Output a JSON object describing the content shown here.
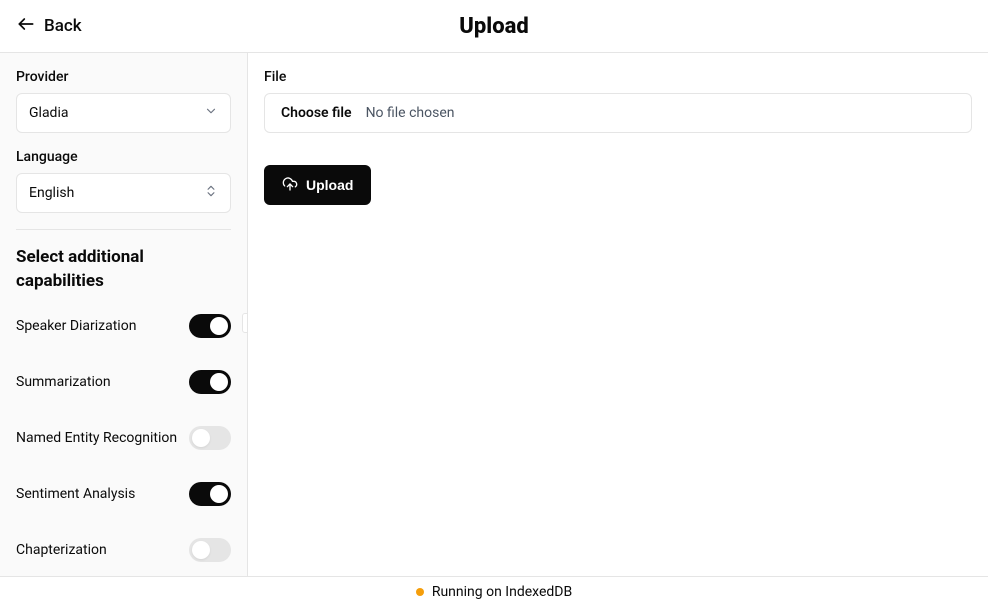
{
  "header": {
    "back_label": "Back",
    "title": "Upload"
  },
  "sidebar": {
    "provider_label": "Provider",
    "provider_value": "Gladia",
    "language_label": "Language",
    "language_value": "English",
    "section_heading": "Select additional capabilities",
    "capabilities": [
      {
        "label": "Speaker Diarization",
        "on": true
      },
      {
        "label": "Summarization",
        "on": true
      },
      {
        "label": "Named Entity Recognition",
        "on": false
      },
      {
        "label": "Sentiment Analysis",
        "on": true
      },
      {
        "label": "Chapterization",
        "on": false
      }
    ]
  },
  "main": {
    "file_label": "File",
    "choose_file_label": "Choose file",
    "no_file_text": "No file chosen",
    "upload_button_label": "Upload"
  },
  "footer": {
    "status_text": "Running on IndexedDB",
    "status_color": "#f59e0b"
  }
}
